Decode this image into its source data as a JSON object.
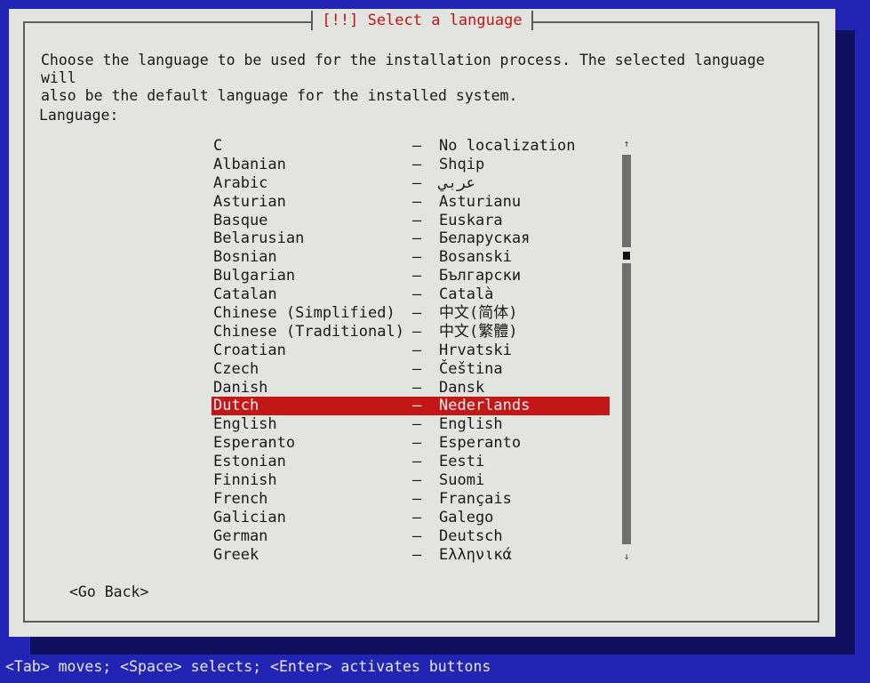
{
  "dialog": {
    "title": "[!!] Select a language",
    "description": "Choose the language to be used for the installation process. The selected language will\nalso be the default language for the installed system.",
    "list_label": "Language:",
    "separator": "–",
    "languages": [
      {
        "name": "C",
        "native": "No localization"
      },
      {
        "name": "Albanian",
        "native": "Shqip"
      },
      {
        "name": "Arabic",
        "native": "عربي"
      },
      {
        "name": "Asturian",
        "native": "Asturianu"
      },
      {
        "name": "Basque",
        "native": "Euskara"
      },
      {
        "name": "Belarusian",
        "native": "Беларуская"
      },
      {
        "name": "Bosnian",
        "native": "Bosanski"
      },
      {
        "name": "Bulgarian",
        "native": "Български"
      },
      {
        "name": "Catalan",
        "native": "Català"
      },
      {
        "name": "Chinese (Simplified)",
        "native": "中文(简体)"
      },
      {
        "name": "Chinese (Traditional)",
        "native": "中文(繁體)"
      },
      {
        "name": "Croatian",
        "native": "Hrvatski"
      },
      {
        "name": "Czech",
        "native": "Čeština"
      },
      {
        "name": "Danish",
        "native": "Dansk"
      },
      {
        "name": "Dutch",
        "native": "Nederlands"
      },
      {
        "name": "English",
        "native": "English"
      },
      {
        "name": "Esperanto",
        "native": "Esperanto"
      },
      {
        "name": "Estonian",
        "native": "Eesti"
      },
      {
        "name": "Finnish",
        "native": "Suomi"
      },
      {
        "name": "French",
        "native": "Français"
      },
      {
        "name": "Galician",
        "native": "Galego"
      },
      {
        "name": "German",
        "native": "Deutsch"
      },
      {
        "name": "Greek",
        "native": "Ελληνικά"
      }
    ],
    "selected_index": 14,
    "scrollbar": {
      "up_arrow": "↑",
      "down_arrow": "↓"
    },
    "go_back_label": "<Go Back>"
  },
  "status_bar": {
    "text": "<Tab> moves; <Space> selects; <Enter> activates buttons"
  },
  "colors": {
    "background_blue": "#2224b4",
    "dialog_gray": "#e2e4e0",
    "title_red": "#c21414",
    "selection_red": "#c41818"
  }
}
